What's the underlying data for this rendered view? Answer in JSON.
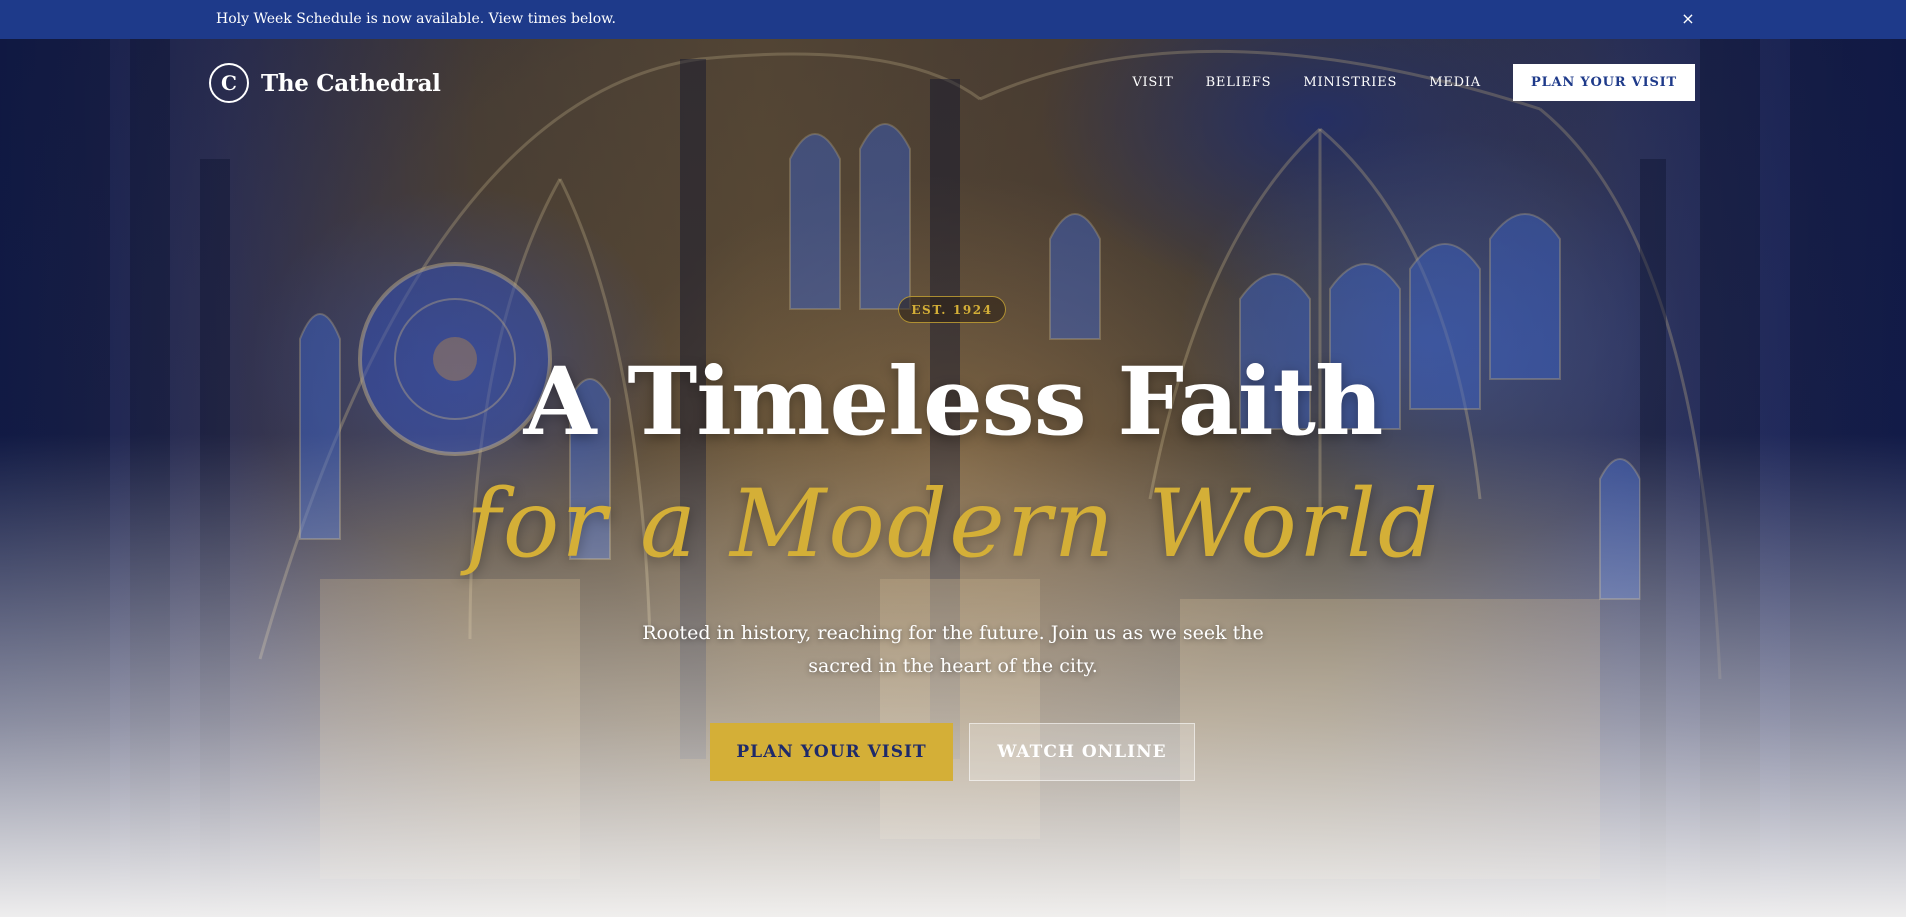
{
  "announcement": {
    "text": "Holy Week Schedule is now available. View times below.",
    "close_icon": "×"
  },
  "brand": {
    "logo_letter": "C",
    "name": "The Cathedral"
  },
  "nav": {
    "items": [
      {
        "label": "VISIT"
      },
      {
        "label": "BELIEFS"
      },
      {
        "label": "MINISTRIES"
      },
      {
        "label": "MEDIA"
      }
    ],
    "cta_label": "PLAN YOUR VISIT"
  },
  "hero": {
    "badge": "EST. 1924",
    "headline_line1": "A Timeless Faith",
    "headline_line2": "for a Modern World",
    "subtext": "Rooted in history, reaching for the future. Join us as we seek the sacred in the heart of the city.",
    "primary_button": "PLAN YOUR VISIT",
    "secondary_button": "WATCH ONLINE"
  },
  "colors": {
    "navy": "#1e3a8a",
    "gold": "#d4af37",
    "white": "#ffffff"
  },
  "icons": {
    "logo": "circle-c-logo-icon",
    "close": "close-icon"
  }
}
